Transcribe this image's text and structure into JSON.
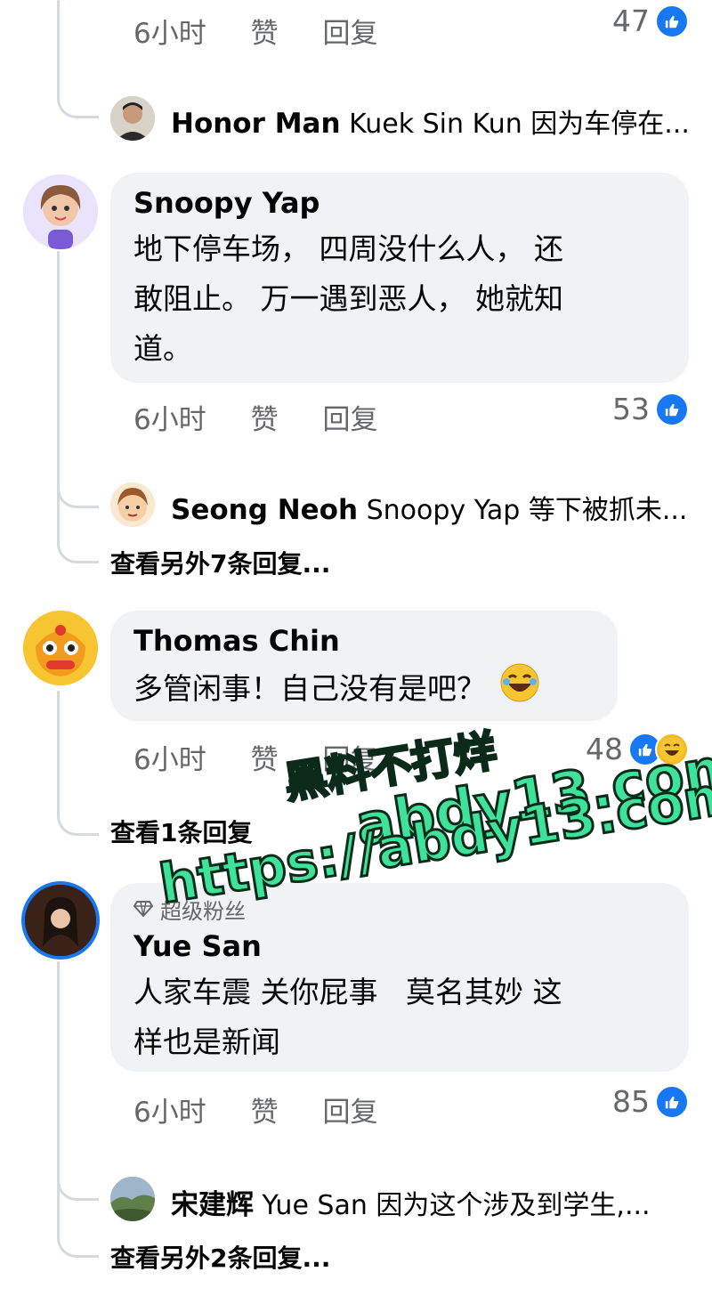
{
  "top_comment_footer": {
    "time": "6小时",
    "like": "赞",
    "reply": "回复",
    "reactions": "47"
  },
  "reply_1": {
    "name": "Honor Man",
    "text": "Kuek Sin Kun 因为车停在..."
  },
  "comment_snoopy": {
    "name": "Snoopy Yap",
    "lines": [
      "地下停车场， 四周没什么人， 还",
      "敢阻止。 万一遇到恶人， 她就知",
      "道。"
    ],
    "time": "6小时",
    "like": "赞",
    "reply": "回复",
    "reactions": "53"
  },
  "reply_2": {
    "name": "Seong Neoh",
    "text": "Snoopy Yap 等下被抓未..."
  },
  "more_replies_1": "查看另外7条回复...",
  "comment_thomas": {
    "name": "Thomas Chin",
    "text": "多管闲事！自己没有是吧？",
    "time": "6小时",
    "like": "赞",
    "reply": "回复",
    "reactions": "48"
  },
  "more_replies_2": "查看1条回复",
  "comment_yue": {
    "badge": "超级粉丝",
    "name": "Yue San",
    "lines": [
      "人家车震 关你屁事   莫名其妙 这",
      "样也是新闻"
    ],
    "time": "6小时",
    "like": "赞",
    "reply": "回复",
    "reactions": "85"
  },
  "reply_3": {
    "name": "宋建辉",
    "text": "Yue San 因为这个涉及到学生,..."
  },
  "more_replies_3": "查看另外2条回复...",
  "watermark": {
    "line1": "黑料不打烊",
    "line2": "abdy13.com",
    "line3": "https://abdy13.com"
  },
  "colors": {
    "like_blue": "#1877f2",
    "bubble_bg": "#f0f2f5",
    "meta_gray": "#65676b",
    "watermark_green": "#3ee29a"
  }
}
